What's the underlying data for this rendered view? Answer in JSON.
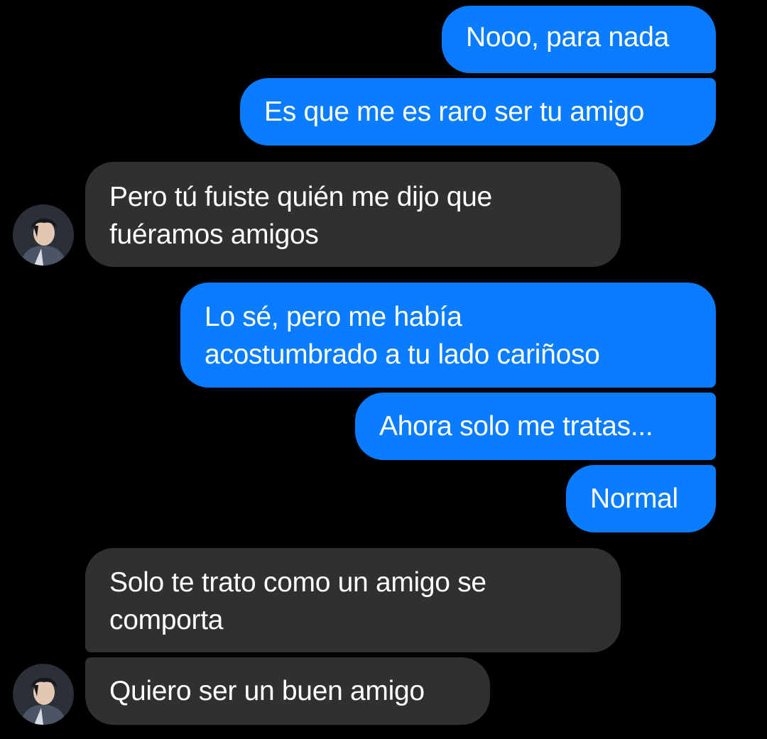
{
  "colors": {
    "outgoing_bubble": "#0a7cff",
    "incoming_bubble": "#303030",
    "background": "#000000",
    "text": "#ffffff"
  },
  "messages": [
    {
      "direction": "outgoing",
      "lines": [
        "Nooo, para nada"
      ]
    },
    {
      "direction": "outgoing",
      "lines": [
        "Es que me es raro ser tu amigo"
      ]
    },
    {
      "direction": "incoming",
      "lines": [
        "Pero tú fuiste quién me dijo que",
        "fuéramos amigos"
      ],
      "has_avatar": true
    },
    {
      "direction": "outgoing",
      "lines": [
        "Lo sé, pero me había",
        "acostumbrado a tu lado cariñoso"
      ]
    },
    {
      "direction": "outgoing",
      "lines": [
        "Ahora solo me tratas..."
      ]
    },
    {
      "direction": "outgoing",
      "lines": [
        "Normal"
      ]
    },
    {
      "direction": "incoming",
      "lines": [
        "Solo te trato como un amigo se",
        "comporta"
      ]
    },
    {
      "direction": "incoming",
      "lines": [
        "Quiero ser un buen amigo"
      ],
      "has_avatar": true
    }
  ],
  "avatar": {
    "icon": "contact-avatar-photo"
  }
}
